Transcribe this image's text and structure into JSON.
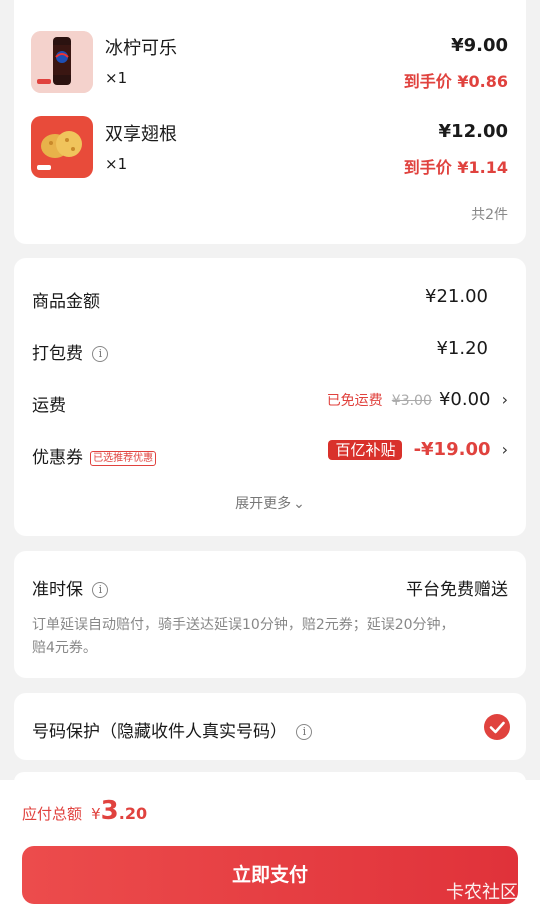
{
  "items": [
    {
      "name": "冰柠可乐",
      "qty": "×1",
      "price": "¥9.00",
      "net_label": "到手价",
      "net_price": "¥0.86",
      "image": "cola-can"
    },
    {
      "name": "双享翅根",
      "qty": "×1",
      "price": "¥12.00",
      "net_label": "到手价",
      "net_price": "¥1.14",
      "image": "fried-chicken"
    }
  ],
  "items_count": "共2件",
  "fees": {
    "goods_label": "商品金额",
    "goods_value": "¥21.00",
    "packing_label": "打包费",
    "packing_value": "¥1.20",
    "delivery_label": "运费",
    "delivery_tag": "已免运费",
    "delivery_original": "¥3.00",
    "delivery_value": "¥0.00",
    "coupon_label": "优惠券",
    "coupon_tag": "已选推荐优惠",
    "coupon_badge": "百亿补贴",
    "coupon_value": "-¥19.00",
    "expand": "展开更多"
  },
  "ontime": {
    "title": "准时保",
    "right": "平台免费赠送",
    "desc_line1": "订单延误自动赔付，骑手送达延误10分钟，赔2元券；延误20分钟，",
    "desc_line2": "赔4元券。"
  },
  "privacy": {
    "label": "号码保护（隐藏收件人真实号码）",
    "checked": true
  },
  "total": {
    "label": "应付总额",
    "currency": "¥",
    "int": "3",
    "dec": ".20"
  },
  "pay_button": "立即支付",
  "watermark": "卡农社区",
  "colors": {
    "accent": "#e0423e",
    "badge": "#d9312b"
  }
}
